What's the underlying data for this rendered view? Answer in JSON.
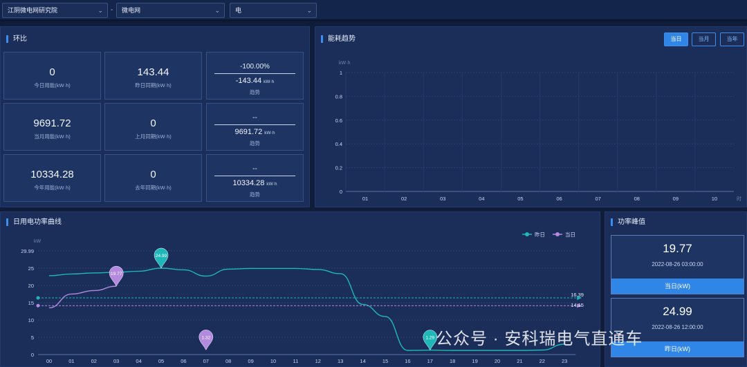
{
  "filters": {
    "org": "江阴微电网研究院",
    "grid": "微电网",
    "energy_type": "电",
    "separator": "-"
  },
  "ratio_panel": {
    "title": "环比",
    "cards": {
      "today": {
        "value": "0",
        "label": "今日用能(kW·h)"
      },
      "yesterday_same": {
        "value": "143.44",
        "label": "昨日同期(kW·h)"
      },
      "trend_day": {
        "pct": "-100.00%",
        "value": "-143.44",
        "unit": "kW·h",
        "label": "趋势"
      },
      "month": {
        "value": "9691.72",
        "label": "当月用能(kW·h)"
      },
      "last_month_same": {
        "value": "0",
        "label": "上月同期(kW·h)"
      },
      "trend_month": {
        "pct": "--",
        "value": "9691.72",
        "unit": "kW·h",
        "label": "趋势"
      },
      "year": {
        "value": "10334.28",
        "label": "今年用能(kW·h)"
      },
      "last_year_same": {
        "value": "0",
        "label": "去年同期(kW·h)"
      },
      "trend_year": {
        "pct": "--",
        "value": "10334.28",
        "unit": "kW·h",
        "label": "趋势"
      }
    }
  },
  "trend_panel": {
    "title": "能耗趋势",
    "tabs": [
      "当日",
      "当月",
      "当年"
    ],
    "active_tab": "当日",
    "unit": "kW·h",
    "x_suffix": "时"
  },
  "power_panel": {
    "title": "日用电功率曲线",
    "unit": "kW",
    "legend": [
      "昨日",
      "当日"
    ]
  },
  "peak_panel": {
    "title": "功率峰值",
    "today": {
      "value": "19.77",
      "time": "2022-08-26 03:00:00",
      "label": "当日(kW)"
    },
    "yesterday": {
      "value": "24.99",
      "time": "2022-08-26 12:00:00",
      "label": "昨日(kW)"
    }
  },
  "watermark": "公众号 · 安科瑞电气直通车",
  "colors": {
    "accent": "#2f86e6",
    "yesterday_series": "#1fb8b8",
    "today_series": "#b48ae0"
  },
  "chart_data": [
    {
      "type": "bar",
      "title": "",
      "ylabel": "kW·h",
      "categories": [
        "01",
        "02",
        "03",
        "04",
        "05",
        "06",
        "07",
        "08",
        "09",
        "10"
      ],
      "values": [
        0,
        0,
        0,
        0,
        0,
        0,
        0,
        0,
        0,
        0
      ],
      "ylim": [
        0,
        1
      ],
      "yticks": [
        "0",
        "0.2",
        "0.4",
        "0.6",
        "0.8",
        "1"
      ],
      "grid": true
    },
    {
      "type": "line",
      "title": "",
      "ylabel": "kW",
      "x": [
        "00",
        "01",
        "02",
        "03",
        "04",
        "05",
        "06",
        "07",
        "08",
        "09",
        "10",
        "11",
        "12",
        "13",
        "14",
        "15",
        "16",
        "17",
        "18",
        "19",
        "20",
        "21",
        "22",
        "23"
      ],
      "ylim": [
        0,
        29.99
      ],
      "yticks": [
        "0",
        "5",
        "10",
        "15",
        "20",
        "25",
        "29.99"
      ],
      "legend_position": "top-right",
      "series": [
        {
          "name": "昨日",
          "values": [
            22.8,
            23.3,
            23.6,
            23.8,
            24.1,
            24.99,
            24.5,
            22.7,
            24.7,
            24.9,
            24.9,
            24.9,
            24.6,
            23.4,
            14.5,
            11.0,
            1.2,
            1.29,
            1.2,
            1.2,
            1.2,
            1.2,
            1.3,
            3.0
          ],
          "average": 16.39,
          "max": {
            "x": "05",
            "value": "24.99"
          },
          "min": {
            "x": "17",
            "value": "1.29"
          }
        },
        {
          "name": "当日",
          "values": [
            13.5,
            17.5,
            18.5,
            19.77
          ],
          "average": 14.15,
          "max": {
            "x": "03",
            "value": "19.77"
          },
          "min": {
            "x": "07",
            "value": "1.32"
          }
        }
      ],
      "avg_labels": [
        "16.39",
        "14.15"
      ]
    }
  ]
}
